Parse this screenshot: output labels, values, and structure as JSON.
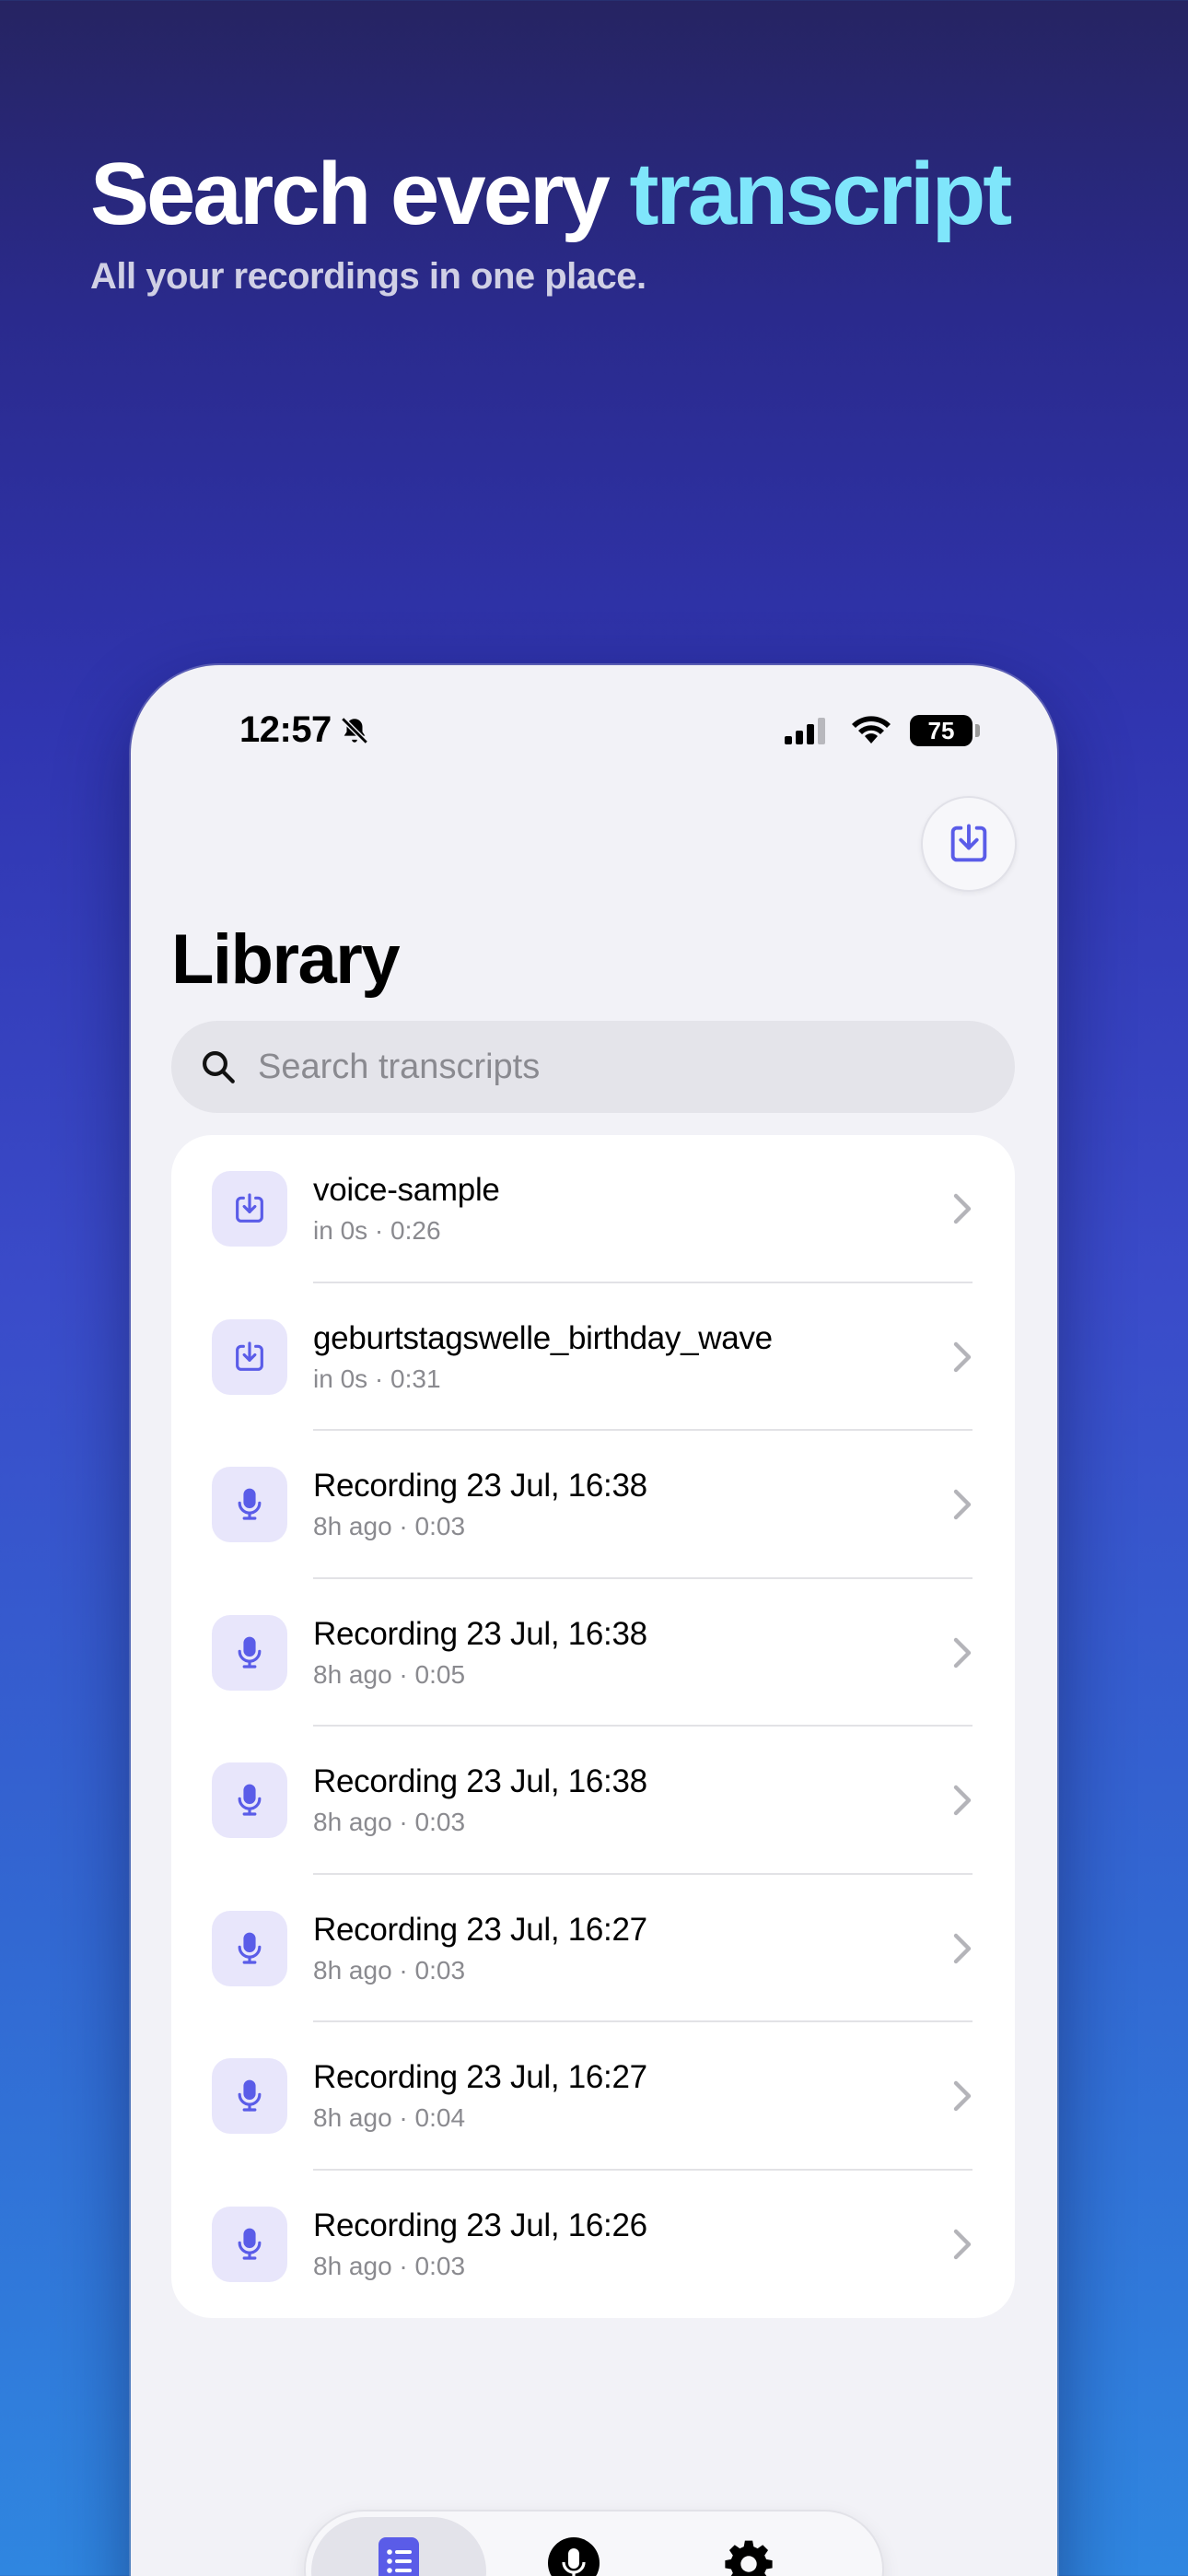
{
  "hero": {
    "title_main": "Search every ",
    "title_accent": "transcript",
    "subtitle": "All your recordings in one place."
  },
  "status_bar": {
    "time": "12:57",
    "battery": "75"
  },
  "header": {
    "title": "Library",
    "import_icon": "tray-arrow-down-icon"
  },
  "search": {
    "placeholder": "Search transcripts",
    "value": ""
  },
  "recordings": [
    {
      "title": "voice-sample",
      "when": "in 0s",
      "duration": "0:26",
      "icon": "import-icon"
    },
    {
      "title": "geburtstagswelle_birthday_wave",
      "when": "in 0s",
      "duration": "0:31",
      "icon": "import-icon"
    },
    {
      "title": "Recording 23 Jul, 16:38",
      "when": "8h ago",
      "duration": "0:03",
      "icon": "microphone-icon"
    },
    {
      "title": "Recording 23 Jul, 16:38",
      "when": "8h ago",
      "duration": "0:05",
      "icon": "microphone-icon"
    },
    {
      "title": "Recording 23 Jul, 16:38",
      "when": "8h ago",
      "duration": "0:03",
      "icon": "microphone-icon"
    },
    {
      "title": "Recording 23 Jul, 16:27",
      "when": "8h ago",
      "duration": "0:03",
      "icon": "microphone-icon"
    },
    {
      "title": "Recording 23 Jul, 16:27",
      "when": "8h ago",
      "duration": "0:04",
      "icon": "microphone-icon"
    },
    {
      "title": "Recording 23 Jul, 16:26",
      "when": "8h ago",
      "duration": "0:03",
      "icon": "microphone-icon"
    }
  ],
  "tabs": [
    {
      "name": "library",
      "icon": "list-icon",
      "active": true
    },
    {
      "name": "record",
      "icon": "microphone-icon",
      "active": false
    },
    {
      "name": "settings",
      "icon": "gear-icon",
      "active": false
    }
  ],
  "colors": {
    "accent": "#5a5ce8",
    "accent_soft": "#e8e6fb",
    "hero_accent": "#7fe6fb"
  }
}
